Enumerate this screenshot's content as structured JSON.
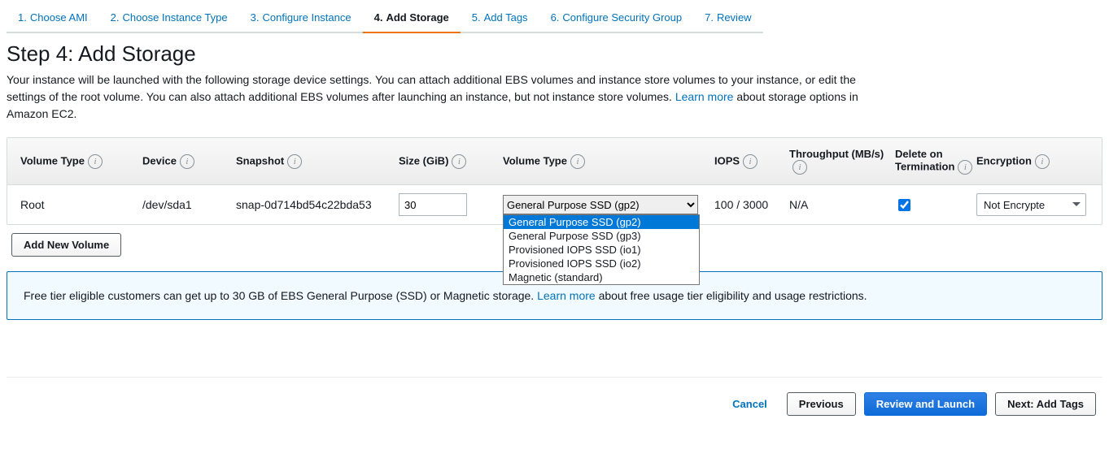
{
  "tabs": [
    {
      "num": "1.",
      "label": "Choose AMI"
    },
    {
      "num": "2.",
      "label": "Choose Instance Type"
    },
    {
      "num": "3.",
      "label": "Configure Instance"
    },
    {
      "num": "4.",
      "label": "Add Storage"
    },
    {
      "num": "5.",
      "label": "Add Tags"
    },
    {
      "num": "6.",
      "label": "Configure Security Group"
    },
    {
      "num": "7.",
      "label": "Review"
    }
  ],
  "active_tab_index": 3,
  "page_title": "Step 4: Add Storage",
  "desc_part1": "Your instance will be launched with the following storage device settings. You can attach additional EBS volumes and instance store volumes to your instance, or edit the settings of the root volume. You can also attach additional EBS volumes after launching an instance, but not instance store volumes. ",
  "desc_learn_more": "Learn more",
  "desc_part2": " about storage options in Amazon EC2.",
  "headers": {
    "c1": "Volume Type",
    "c2": "Device",
    "c3": "Snapshot",
    "c4": "Size (GiB)",
    "c5": "Volume Type",
    "c6": "IOPS",
    "c7": "Throughput (MB/s)",
    "c8": "Delete on Termination",
    "c9": "Encryption"
  },
  "row": {
    "vol_kind": "Root",
    "device": "/dev/sda1",
    "snapshot": "snap-0d714bd54c22bda53",
    "size": "30",
    "vol_type_selected": "General Purpose SSD (gp2)",
    "vol_type_options": [
      "General Purpose SSD (gp2)",
      "General Purpose SSD (gp3)",
      "Provisioned IOPS SSD (io1)",
      "Provisioned IOPS SSD (io2)",
      "Magnetic (standard)"
    ],
    "iops": "100 / 3000",
    "throughput": "N/A",
    "delete_on_term": true,
    "encryption": "Not Encrypte"
  },
  "add_volume_label": "Add New Volume",
  "notice_part1": "Free tier eligible customers can get up to 30 GB of EBS General Purpose (SSD) or Magnetic storage. ",
  "notice_learn_more": "Learn more",
  "notice_part2": " about free usage tier eligibility and usage restrictions.",
  "footer": {
    "cancel": "Cancel",
    "previous": "Previous",
    "review": "Review and Launch",
    "next": "Next: Add Tags"
  }
}
